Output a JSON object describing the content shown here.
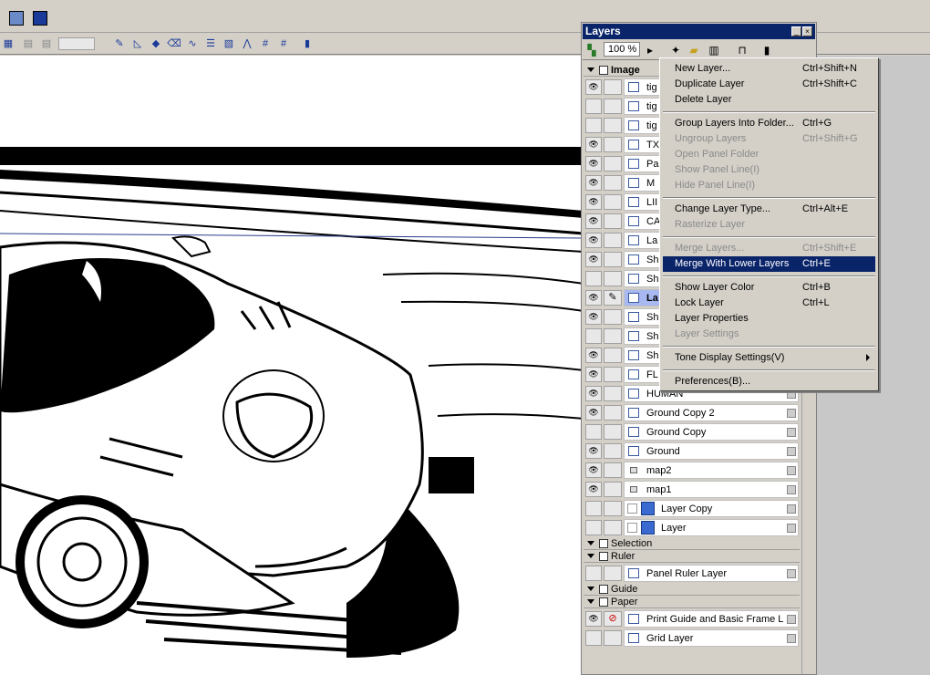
{
  "panel": {
    "title": "Layers",
    "zoom": "100 %"
  },
  "sections": {
    "image": "Image",
    "selection": "Selection",
    "ruler": "Ruler",
    "guide": "Guide",
    "paper": "Paper"
  },
  "layers": [
    {
      "name": "tig",
      "eye": true
    },
    {
      "name": "tig",
      "eye": false
    },
    {
      "name": "tig",
      "eye": false
    },
    {
      "name": "TX",
      "eye": true
    },
    {
      "name": "Pa",
      "eye": true
    },
    {
      "name": "M",
      "eye": true
    },
    {
      "name": "LII",
      "eye": true
    },
    {
      "name": "CA",
      "eye": true
    },
    {
      "name": "La",
      "eye": true
    },
    {
      "name": "Sh",
      "eye": true
    },
    {
      "name": "Sh",
      "eye": false
    },
    {
      "name": "La",
      "eye": true,
      "selected": true
    },
    {
      "name": "Sh",
      "eye": true
    },
    {
      "name": "Sh",
      "eye": false
    },
    {
      "name": "Sh",
      "eye": true
    },
    {
      "name": "FL",
      "eye": true
    },
    {
      "name": "HUMAN",
      "eye": true
    },
    {
      "name": "Ground Copy 2",
      "eye": true
    },
    {
      "name": "Ground Copy",
      "eye": false
    },
    {
      "name": "Ground",
      "eye": true
    },
    {
      "name": "map2",
      "eye": true
    },
    {
      "name": "map1",
      "eye": true
    },
    {
      "name": "Layer Copy",
      "eye": false
    },
    {
      "name": "Layer",
      "eye": false
    }
  ],
  "ruler_layer": "Panel Ruler Layer",
  "guide_layers": [
    "Print Guide and Basic Frame L...",
    "Grid Layer"
  ],
  "menu": [
    {
      "label": "New Layer...",
      "shortcut": "Ctrl+Shift+N",
      "disabled": false
    },
    {
      "label": "Duplicate Layer",
      "shortcut": "Ctrl+Shift+C",
      "disabled": false
    },
    {
      "label": "Delete Layer",
      "shortcut": "",
      "disabled": false
    },
    {
      "label": "Group Layers Into Folder...",
      "shortcut": "Ctrl+G",
      "disabled": false
    },
    {
      "label": "Ungroup Layers",
      "shortcut": "Ctrl+Shift+G",
      "disabled": true
    },
    {
      "label": "Open Panel Folder",
      "shortcut": "",
      "disabled": true
    },
    {
      "label": "Show Panel Line(I)",
      "shortcut": "",
      "disabled": true
    },
    {
      "label": "Hide Panel Line(I)",
      "shortcut": "",
      "disabled": true
    },
    {
      "label": "Change Layer Type...",
      "shortcut": "Ctrl+Alt+E",
      "disabled": false
    },
    {
      "label": "Rasterize Layer",
      "shortcut": "",
      "disabled": true
    },
    {
      "label": "Merge Layers...",
      "shortcut": "Ctrl+Shift+E",
      "disabled": true
    },
    {
      "label": "Merge With Lower Layers",
      "shortcut": "Ctrl+E",
      "disabled": false,
      "highlighted": true
    },
    {
      "label": "Show Layer Color",
      "shortcut": "Ctrl+B",
      "disabled": false
    },
    {
      "label": "Lock Layer",
      "shortcut": "Ctrl+L",
      "disabled": false
    },
    {
      "label": "Layer Properties",
      "shortcut": "",
      "disabled": false
    },
    {
      "label": "Layer Settings",
      "shortcut": "",
      "disabled": true
    },
    {
      "label": "Tone Display Settings(V)",
      "shortcut": "",
      "disabled": false,
      "submenu": true
    },
    {
      "label": "Preferences(B)...",
      "shortcut": "",
      "disabled": false
    }
  ]
}
